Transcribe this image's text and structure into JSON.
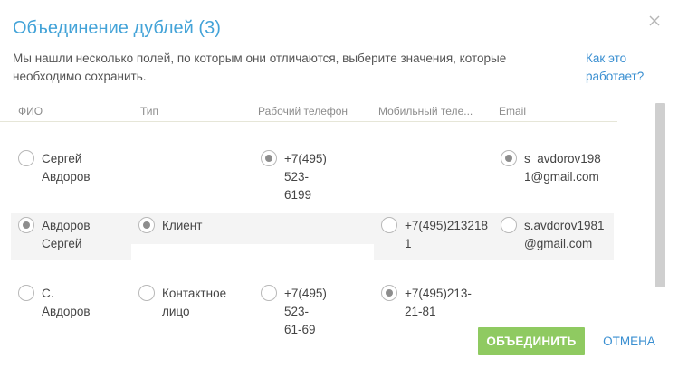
{
  "dialog": {
    "title": "Объединение дублей (3)",
    "description": "Мы нашли несколько полей, по которым они отличаются, выберите значения, которые необходимо сохранить.",
    "help_link": "Как это работает?",
    "merge_label": "ОБЪЕДИНИТЬ",
    "cancel_label": "ОТМЕНА"
  },
  "columns": [
    "ФИО",
    "Тип",
    "Рабочий телефон",
    "Мобильный теле...",
    "Email"
  ],
  "rows": [
    {
      "name": {
        "value": "Сергей\nАвдоров",
        "selected": false
      },
      "type": null,
      "work_phone": {
        "value": "+7(495) 523-\n6199",
        "selected": true
      },
      "mobile_phone": null,
      "email": {
        "value": "s_avdorov198\n1@gmail.com",
        "selected": true
      }
    },
    {
      "name": {
        "value": "Авдоров\nСергей",
        "selected": true
      },
      "type": {
        "value": "Клиент",
        "selected": true
      },
      "work_phone": null,
      "mobile_phone": {
        "value": "+7(495)213218\n1",
        "selected": false
      },
      "email": {
        "value": "s.avdorov1981\n@gmail.com",
        "selected": false
      }
    },
    {
      "name": {
        "value": "С. Авдоров",
        "selected": false
      },
      "type": {
        "value": "Контактное\nлицо",
        "selected": false
      },
      "work_phone": {
        "value": "+7(495) 523-\n61-69",
        "selected": false
      },
      "mobile_phone": {
        "value": "+7(495)213-\n21-81",
        "selected": true
      },
      "email": null
    }
  ],
  "colors": {
    "title": "#43a3d8",
    "link": "#3a8fd1",
    "merge_button": "#8fca61",
    "highlight_row": "#f4f4f4"
  },
  "icons": {
    "close": "close-icon"
  }
}
